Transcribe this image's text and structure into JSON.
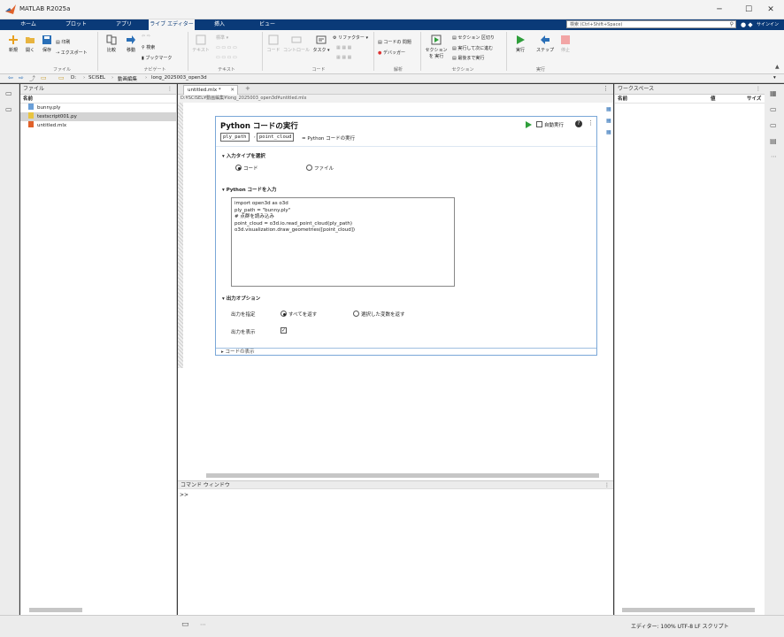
{
  "window": {
    "title": "MATLAB R2025a"
  },
  "ribbon": {
    "tabs": [
      "ホーム",
      "プロット",
      "アプリ",
      "ライブ エディター",
      "挿入",
      "ビュー"
    ],
    "active_tab": 3,
    "search_placeholder": "検索 (Ctrl+Shift+Space)",
    "signin": "サインイン"
  },
  "toolstrip": {
    "file": {
      "new": "新規",
      "open": "開く",
      "save": "保存",
      "print": "印刷",
      "export": "エクスポート",
      "group": "ファイル"
    },
    "navigate": {
      "compare": "比較",
      "goto": "移動",
      "find": "検索",
      "bookmark": "ブックマーク",
      "group": "ナビゲート"
    },
    "text": {
      "text": "テキスト",
      "normal": "標準",
      "group": "テキスト"
    },
    "code": {
      "code": "コード",
      "control": "コントロール",
      "task": "タスク",
      "refactor": "リファクター",
      "group": "コード"
    },
    "analyze": {
      "code_issues": "コードの 問題",
      "debugger": "デバッガー",
      "group": "解析"
    },
    "section": {
      "run_section": "セクションを 実行",
      "section_break": "セクション 区切り",
      "run_advance": "実行して次に進む",
      "run_to_end": "最後まで実行",
      "group": "セクション"
    },
    "run": {
      "run": "実行",
      "step": "ステップ",
      "stop": "停止",
      "group": "実行"
    }
  },
  "address": {
    "crumbs": [
      "D:",
      "SCISEL",
      "動画編集",
      "long_2025003_open3d"
    ]
  },
  "files": {
    "title": "ファイル",
    "column_name": "名前",
    "items": [
      {
        "name": "bunny.ply",
        "selected": false
      },
      {
        "name": "testscript001.py",
        "selected": true
      },
      {
        "name": "untitled.mlx",
        "selected": false
      }
    ]
  },
  "editor": {
    "tab_label": "untitled.mlx *",
    "path": "D:¥SCISEL¥動画編集¥long_2025003_open3d¥untitled.mlx",
    "task": {
      "title": "Python コードの実行",
      "var1": "ply_path",
      "var2": "point_cloud",
      "equals_text": "= Python コードの実行",
      "autorun": "自動実行",
      "input_type_section": "入力タイプを選択",
      "radio_code": "コード",
      "radio_file": "ファイル",
      "code_section": "Python コードを入力",
      "code_lines": [
        "import open3d as o3d",
        "",
        "ply_path = \"bunny.ply\"",
        "# 点群を読み込み",
        "point_cloud = o3d.io.read_point_cloud(ply_path)",
        "o3d.visualization.draw_geometries([point_cloud])"
      ],
      "output_section": "出力オプション",
      "output_spec_label": "出力を指定",
      "output_all": "すべてを返す",
      "output_selected": "選択した変数を返す",
      "output_show_label": "出力を表示",
      "show_code": "コードの表示"
    }
  },
  "command": {
    "title": "コマンド ウィンドウ",
    "prompt": ">>"
  },
  "workspace": {
    "title": "ワークスペース",
    "col_name": "名前",
    "col_value": "値",
    "col_size": "サイズ"
  },
  "status": {
    "text": "エディター: 100%   UTF-8   LF   スクリプト"
  },
  "colors": {
    "ribbon_bg": "#0a3a78",
    "run_green": "#2e9e3a",
    "task_border": "#7aa7d8",
    "stop_red": "#e06060"
  }
}
